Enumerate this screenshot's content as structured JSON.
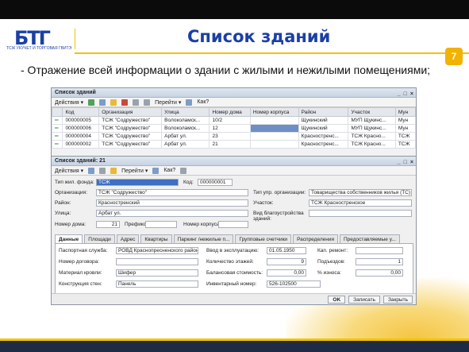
{
  "slide": {
    "title": "Список зданий",
    "subtitle": "- Отражение всей информации о здании с жилыми и нежилыми помещениями;",
    "page_number": "7",
    "logo_text": "БТГ",
    "logo_sub": "ТСЖ УКУЧЕТ И ТОРГОВАЯ ГВИТЭ"
  },
  "list_window": {
    "title": "Список зданий",
    "toolbar": {
      "actions": "Действия ▾",
      "goto": "Перейти ▾",
      "howto": "Как?"
    },
    "columns": [
      "",
      "Код",
      "Организация",
      "Улица",
      "Номер дома",
      "Номер корпуса",
      "Район",
      "Участок",
      "Мун"
    ],
    "rows": [
      [
        "",
        "000000005",
        "ТСЖ \"Содружество\"",
        "Волоколамск...",
        "10/2",
        "",
        "Щукинский",
        "МУП Щукинс...",
        "Мун"
      ],
      [
        "",
        "000000006",
        "ТСЖ \"Содружество\"",
        "Волоколамск...",
        "12",
        "",
        "Щукинский",
        "МУП Щукинс...",
        "Мун"
      ],
      [
        "",
        "000000004",
        "ТСЖ \"Содружество\"",
        "Арбат ул.",
        "23",
        "",
        "Красностренс...",
        "ТСЖ Красно...",
        "ТСЖ"
      ],
      [
        "",
        "000000002",
        "ТСЖ \"Содружество\"",
        "Арбат ул.",
        "21",
        "",
        "Красностренс...",
        "ТСЖ Красно...",
        "ТСЖ"
      ]
    ]
  },
  "form_window": {
    "title": "Список зданий: 21",
    "toolbar": {
      "actions": "Действия ▾",
      "goto": "Перейти ▾",
      "howto": "Как?"
    },
    "fields": {
      "type_label": "Тип жил. фонда:",
      "type_value": "ТСЖ",
      "code_label": "Код:",
      "code_value": "000000001",
      "org_label": "Организация:",
      "org_value": "ТСЖ \"Содружество\"",
      "mgmt_label": "Тип упр. организации:",
      "mgmt_value": "Товарищества собственников жилья (ТС)",
      "district_label": "Район:",
      "district_value": "Красностренский",
      "area_label": "Участок:",
      "area_value": "ТСЖ Красностренское",
      "street_label": "Улица:",
      "street_value": "Арбат ул.",
      "improvement_label": "Вид благоустройства зданий:",
      "house_label": "Номер дома:",
      "house_value": "21",
      "prefix_label": "Префикс:",
      "building_label": "Номер корпуса:"
    },
    "tabs": [
      "Данные",
      "Площади",
      "Адрес",
      "Квартиры",
      "Паркинг /нежилые п...",
      "Групповые счетчики",
      "Распределения",
      "Предоставляемые у..."
    ],
    "panel": {
      "passport_label": "Паспортная служба:",
      "passport_value": "РОВД Краснопресненского района",
      "contract_label": "Номер договора:",
      "roof_label": "Материал кровли:",
      "roof_value": "Шифер",
      "walls_label": "Конструкция стен:",
      "walls_value": "Панель",
      "built_label": "Год постройки:",
      "commission_label": "Ввод в эксплуатацию:",
      "commission_value": "01.05.1950",
      "floors_label": "Количество этажей:",
      "floors_value": "9",
      "balance_label": "Балансовая стоимость:",
      "balance_value": "0,00",
      "inventory_label": "Инвентарный номер:",
      "inventory_value": "526-102500",
      "repair_label": "Кап. ремонт:",
      "entrances_label": "Подъездов:",
      "entrances_value": "1",
      "wear_label": "% износа:",
      "wear_value": "0,00"
    },
    "buttons": {
      "ok": "OK",
      "save": "Записать",
      "close": "Закрыть"
    }
  }
}
